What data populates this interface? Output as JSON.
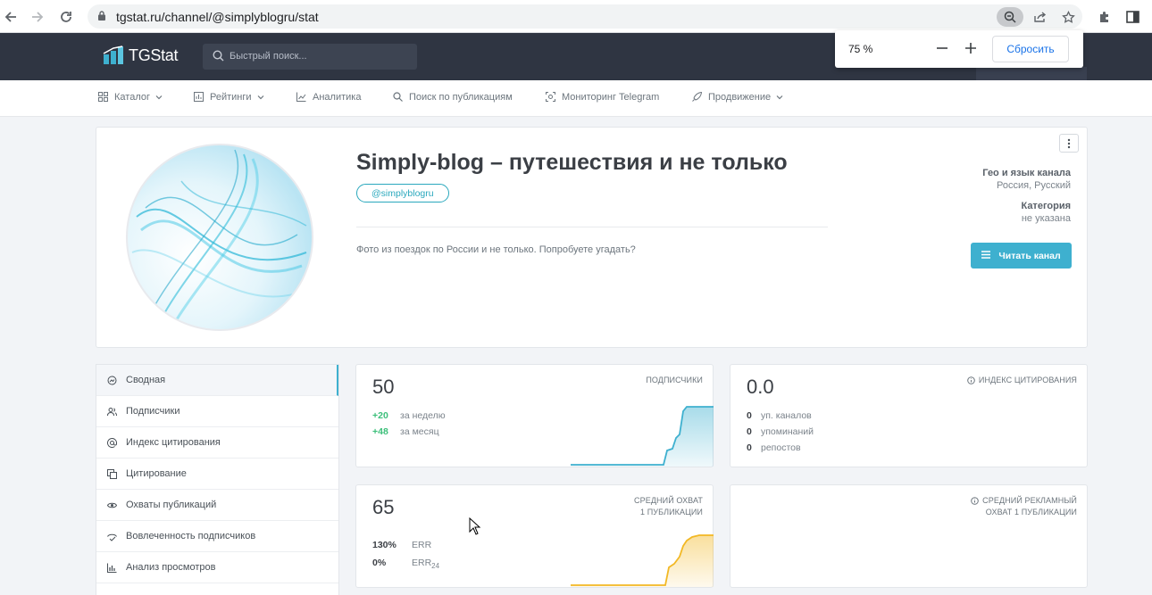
{
  "browser": {
    "url": "tgstat.ru/channel/@simplyblogru/stat",
    "zoom": {
      "value": "75 %",
      "reset_label": "Сбросить"
    }
  },
  "header": {
    "logo_text": "TGStat",
    "search_placeholder": "Быстрый поиск..."
  },
  "menu": [
    {
      "label": "Каталог",
      "icon": "grid-icon",
      "dropdown": true
    },
    {
      "label": "Рейтинги",
      "icon": "rating-icon",
      "dropdown": true
    },
    {
      "label": "Аналитика",
      "icon": "analytics-icon",
      "dropdown": false
    },
    {
      "label": "Поиск по публикациям",
      "icon": "search-icon",
      "dropdown": false
    },
    {
      "label": "Мониторинг Telegram",
      "icon": "monitor-icon",
      "dropdown": false
    },
    {
      "label": "Продвижение",
      "icon": "rocket-icon",
      "dropdown": true
    }
  ],
  "channel": {
    "title": "Simply-blog – путешествия и не только",
    "username": "@simplyblogru",
    "description": "Фото из поездок по России и не только. Попробуете угадать?",
    "geo_label": "Гео и язык канала",
    "geo_value": "Россия, Русский",
    "category_label": "Категория",
    "category_value": "не указана",
    "read_button": "Читать канал"
  },
  "sidebar": {
    "items": [
      {
        "label": "Сводная",
        "icon": "summary-icon",
        "active": true
      },
      {
        "label": "Подписчики",
        "icon": "users-icon",
        "active": false
      },
      {
        "label": "Индекс цитирования",
        "icon": "at-icon",
        "active": false
      },
      {
        "label": "Цитирование",
        "icon": "quote-icon",
        "active": false
      },
      {
        "label": "Охваты публикаций",
        "icon": "eye-icon",
        "active": false
      },
      {
        "label": "Вовлеченность подписчиков",
        "icon": "engagement-icon",
        "active": false
      },
      {
        "label": "Анализ просмотров",
        "icon": "bar-chart-icon",
        "active": false
      }
    ]
  },
  "stats": {
    "subscribers": {
      "value": "50",
      "label": "ПОДПИСЧИКИ",
      "week_delta": "+20",
      "week_text": "за неделю",
      "month_delta": "+48",
      "month_text": "за месяц",
      "color": "#3eb0cf"
    },
    "citation": {
      "value": "0.0",
      "label": "ИНДЕКС ЦИТИРОВАНИЯ",
      "rows": [
        {
          "num": "0",
          "text": "уп. каналов"
        },
        {
          "num": "0",
          "text": "упоминаний"
        },
        {
          "num": "0",
          "text": "репостов"
        }
      ]
    },
    "reach": {
      "value": "65",
      "label_line1": "СРЕДНИЙ ОХВАТ",
      "label_line2": "1 ПУБЛИКАЦИИ",
      "err_value": "130%",
      "err_label": "ERR",
      "err24_value": "0%",
      "err24_label": "ERR",
      "err24_sub": "24",
      "color": "#f2b824"
    },
    "ad_reach": {
      "label_line1": "СРЕДНИЙ РЕКЛАМНЫЙ",
      "label_line2": "ОХВАТ 1 ПУБЛИКАЦИИ"
    }
  }
}
